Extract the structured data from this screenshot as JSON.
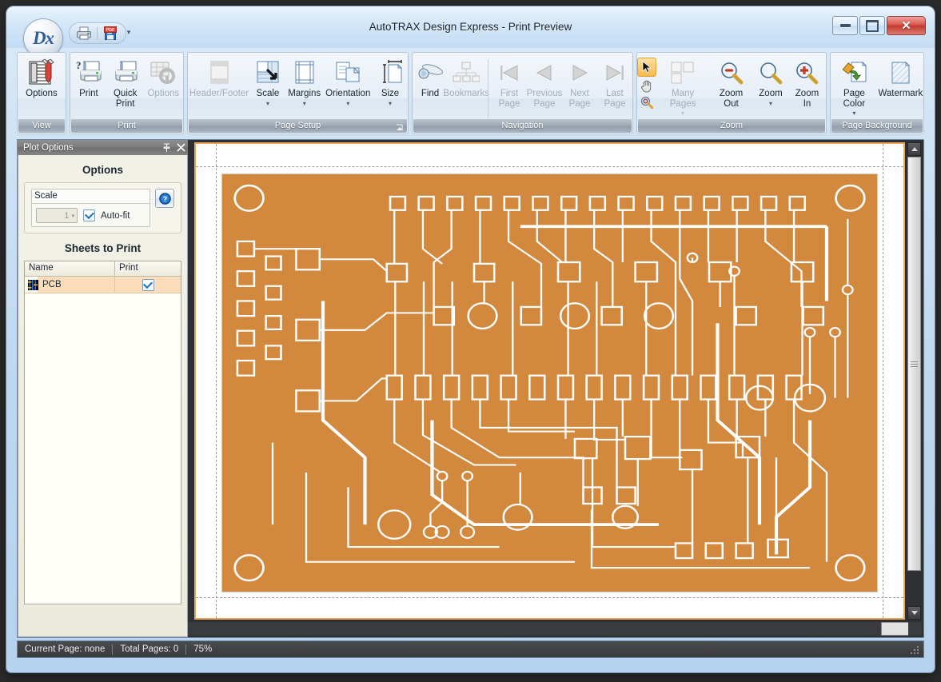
{
  "window": {
    "title": "AutoTRAX Design Express - Print Preview",
    "app_logo": "Dx",
    "controls": {
      "minimize": "minimize-button",
      "maximize": "maximize-button",
      "close": "✕"
    }
  },
  "quick_access": {
    "items": [
      {
        "name": "print-quick-icon",
        "label": "Print"
      },
      {
        "name": "export-pdf-icon",
        "label": "PDF"
      }
    ],
    "more": "▾"
  },
  "ribbon": {
    "groups": [
      {
        "title": "View",
        "buttons": [
          {
            "label": "Options",
            "icon": "options-icon",
            "enabled": true,
            "arrow": ""
          }
        ]
      },
      {
        "title": "Print",
        "buttons": [
          {
            "label": "Print",
            "icon": "print-icon",
            "enabled": true,
            "arrow": ""
          },
          {
            "label": "Quick\nPrint",
            "label1": "Quick",
            "label2": "Print",
            "icon": "quick-print-icon",
            "enabled": true,
            "arrow": ""
          },
          {
            "label": "Options",
            "icon": "print-options-icon",
            "enabled": false,
            "arrow": ""
          }
        ]
      },
      {
        "title": "Page Setup",
        "has_dialog_launcher": true,
        "buttons": [
          {
            "label": "Header/Footer",
            "icon": "header-footer-icon",
            "enabled": false,
            "arrow": ""
          },
          {
            "label": "Scale",
            "icon": "scale-icon",
            "enabled": true,
            "arrow": "▾"
          },
          {
            "label": "Margins",
            "icon": "margins-icon",
            "enabled": true,
            "arrow": "▾"
          },
          {
            "label": "Orientation",
            "icon": "orientation-icon",
            "enabled": true,
            "arrow": "▾"
          },
          {
            "label": "Size",
            "icon": "page-size-icon",
            "enabled": true,
            "arrow": "▾"
          }
        ]
      },
      {
        "title": "Navigation",
        "buttons": [
          {
            "label": "Find",
            "icon": "find-icon",
            "enabled": true,
            "arrow": ""
          },
          {
            "label": "Bookmarks",
            "icon": "bookmarks-icon",
            "enabled": false,
            "arrow": ""
          },
          {
            "label1": "First",
            "label2": "Page",
            "icon": "first-page-icon",
            "enabled": false,
            "arrow": ""
          },
          {
            "label1": "Previous",
            "label2": "Page",
            "icon": "previous-page-icon",
            "enabled": false,
            "arrow": ""
          },
          {
            "label1": "Next",
            "label2": "Page",
            "icon": "next-page-icon",
            "enabled": false,
            "arrow": ""
          },
          {
            "label1": "Last",
            "label2": "Page",
            "icon": "last-page-icon",
            "enabled": false,
            "arrow": ""
          }
        ]
      },
      {
        "title": "Zoom",
        "buttons": [
          {
            "label": "",
            "icon": "pointer-hand-magnifier-tools",
            "enabled": true,
            "arrow": ""
          },
          {
            "label": "Many Pages",
            "icon": "many-pages-icon",
            "enabled": false,
            "arrow": "▾"
          },
          {
            "label": "Zoom Out",
            "icon": "zoom-out-icon",
            "enabled": true,
            "arrow": ""
          },
          {
            "label": "Zoom",
            "icon": "zoom-icon",
            "enabled": true,
            "arrow": "▾"
          },
          {
            "label": "Zoom In",
            "icon": "zoom-in-icon",
            "enabled": true,
            "arrow": ""
          }
        ]
      },
      {
        "title": "Page Background",
        "buttons": [
          {
            "label": "Page Color",
            "icon": "page-color-icon",
            "enabled": true,
            "arrow": "▾"
          },
          {
            "label": "Watermark",
            "icon": "watermark-icon",
            "enabled": true,
            "arrow": ""
          }
        ]
      }
    ]
  },
  "dock": {
    "caption": "Plot Options",
    "pin_icon": "📌",
    "close_icon": "✕",
    "options_header": "Options",
    "scale": {
      "group_label": "Scale",
      "value": "1",
      "dropdown_arrow": "▾",
      "autofit_label": "Auto-fit",
      "autofit_checked": true,
      "help_label": "?"
    },
    "sheets_header": "Sheets to Print",
    "grid": {
      "columns": [
        "Name",
        "Print"
      ],
      "rows": [
        {
          "name": "PCB",
          "icon": "pcb-sheet-icon",
          "print": true
        }
      ]
    }
  },
  "preview": {
    "page_border_color": "#efa652",
    "pcb_color": "#d2893e",
    "trace_color": "#ffffff",
    "scrollbar_vertical": "vertical-scrollbar",
    "scrollbar_horizontal": "horizontal-scrollbar"
  },
  "status": {
    "current_page": "Current Page: none",
    "total_pages": "Total Pages: 0",
    "zoom": "75%"
  }
}
